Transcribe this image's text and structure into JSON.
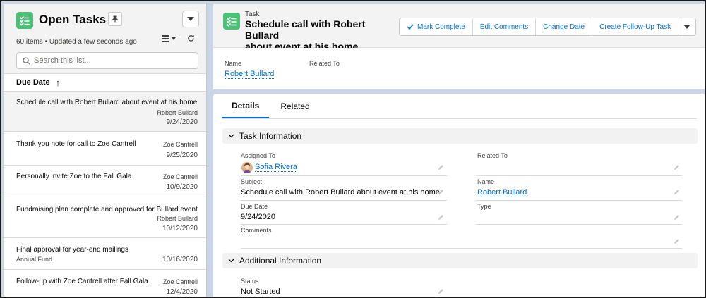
{
  "list": {
    "title": "Open Tasks",
    "meta": "60 items • Updated a few seconds ago",
    "search_placeholder": "Search this list...",
    "sort_label": "Due Date",
    "sort_arrow": "↑",
    "items": [
      {
        "title": "Schedule call with Robert Bullard about event at his home",
        "who": "Robert Bullard",
        "date": "9/24/2020",
        "secondary": ""
      },
      {
        "title": "Thank you note for call to Zoe Cantrell",
        "who": "Zoe Cantrell",
        "date": "9/25/2020",
        "secondary": ""
      },
      {
        "title": "Personally invite Zoe to the Fall Gala",
        "who": "Zoe Cantrell",
        "date": "10/9/2020",
        "secondary": ""
      },
      {
        "title": "Fundraising plan complete and approved for Bullard event",
        "who": "Robert Bullard",
        "date": "10/12/2020",
        "secondary": ""
      },
      {
        "title": "Final approval for year-end mailings",
        "who": "",
        "date": "10/16/2020",
        "secondary": "Annual Fund"
      },
      {
        "title": "Follow-up with Zoe Cantrell after Fall Gala",
        "who": "Zoe Cantrell",
        "date": "12/4/2020",
        "secondary": ""
      }
    ]
  },
  "record": {
    "type_label": "Task",
    "title_line1": "Schedule call with Robert Bullard",
    "title_line2": "about event at his home",
    "buttons": {
      "mark_complete": "Mark Complete",
      "edit_comments": "Edit Comments",
      "change_date": "Change Date",
      "follow_up": "Create Follow-Up Task"
    },
    "highlights": {
      "name_label": "Name",
      "name_value": "Robert Bullard",
      "related_label": "Related To"
    }
  },
  "tabs": {
    "details": "Details",
    "related": "Related"
  },
  "task_info": {
    "section_title": "Task Information",
    "assigned_to_label": "Assigned To",
    "assigned_to_value": "Sofia Rivera",
    "related_to_label": "Related To",
    "subject_label": "Subject",
    "subject_value": "Schedule call with Robert Bullard about event at his home",
    "name_label": "Name",
    "name_value": "Robert Bullard",
    "due_date_label": "Due Date",
    "due_date_value": "9/24/2020",
    "type_label": "Type",
    "comments_label": "Comments"
  },
  "additional_info": {
    "section_title": "Additional Information",
    "status_label": "Status",
    "status_value": "Not Started"
  },
  "colors": {
    "accent": "#0070d2",
    "task_icon": "#4bc076"
  }
}
